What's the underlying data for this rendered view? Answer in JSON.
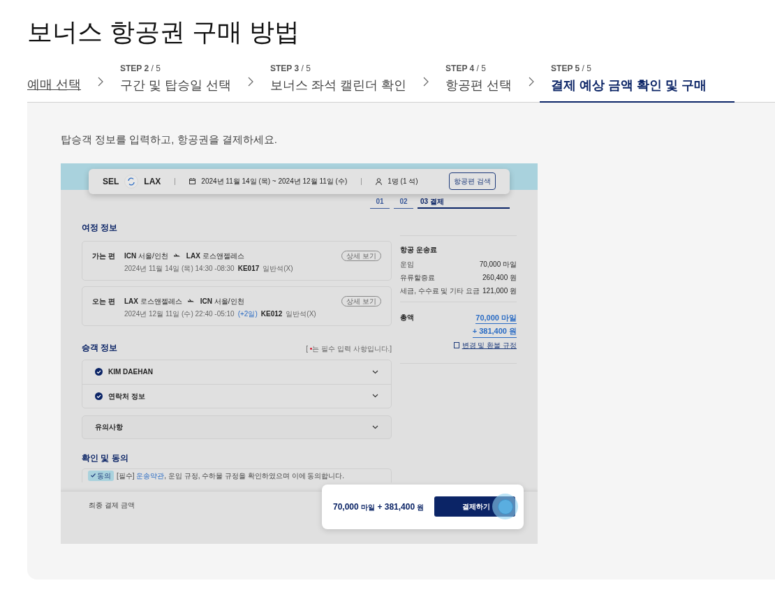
{
  "title": "보너스 항공권 구매 방법",
  "steps": [
    {
      "label": "예매 선택",
      "selected": false
    },
    {
      "step": "STEP 2",
      "total": "/ 5",
      "label": "구간 및 탑승일 선택",
      "selected": false
    },
    {
      "step": "STEP 3",
      "total": "/ 5",
      "label": "보너스 좌석 캘린더 확인",
      "selected": false
    },
    {
      "step": "STEP 4",
      "total": "/ 5",
      "label": "항공편 선택",
      "selected": false
    },
    {
      "step": "STEP 5",
      "total": "/ 5",
      "label": "결제 예상 금액 확인 및 구매",
      "selected": true
    }
  ],
  "instruction": "탑승객 정보를 입력하고, 항공권을 결제하세요.",
  "screenshot": {
    "search_bar": {
      "origin": "SEL",
      "destination": "LAX",
      "dates": "2024년 11월 14일 (목) ~ 2024년 12월 11일 (수)",
      "passengers": "1명 (1 석)",
      "button": "항공편 검색"
    },
    "progress": [
      {
        "label": "01",
        "selected": false
      },
      {
        "label": "02",
        "selected": false
      },
      {
        "label": "03 결제",
        "selected": true
      }
    ],
    "itinerary": {
      "title": "여정 정보",
      "flights": [
        {
          "direction": "가는 편",
          "from_code": "ICN",
          "from_city": "서울/인천",
          "to_code": "LAX",
          "to_city": "로스앤젤레스",
          "times": "2024년 11월 14일 (목) 14:30 -08:30",
          "flight_no": "KE017",
          "cabin": "일반석(X)",
          "button": "상세 보기"
        },
        {
          "direction": "오는 편",
          "from_code": "LAX",
          "from_city": "로스앤젤레스",
          "to_code": "ICN",
          "to_city": "서울/인천",
          "times": "2024년 12월 11일 (수) 22:40 -05:10",
          "extra": "(+2일)",
          "flight_no": "KE012",
          "cabin": "일반석(X)",
          "button": "상세 보기"
        }
      ]
    },
    "fare": {
      "title": "항공 운송료",
      "rows": [
        {
          "label": "운임",
          "value": "70,000 마일"
        },
        {
          "label": "유류할증료",
          "value": "260,400 원"
        },
        {
          "label": "세금, 수수료 및 기타 요금",
          "value": "121,000 원"
        }
      ],
      "total_label": "총액",
      "total_miles": "70,000 마일",
      "total_won": "+ 381,400 원",
      "rules_link": "변경 및 환불 규정"
    },
    "passengers": {
      "title": "승객 정보",
      "note_open": "[",
      "note_mark": "•",
      "note_rest": "는 필수 입력 사항입니다.]",
      "items": [
        {
          "label": "KIM DAEHAN",
          "checked": true
        },
        {
          "label": "연락처 정보",
          "checked": true
        }
      ],
      "notice": "유의사항"
    },
    "agreement": {
      "title": "확인 및 동의",
      "tag": "동의",
      "required": "[필수]",
      "link": "운송약관",
      "text": ", 운임 규정, 수하물 규정을 확인하였으며 이에 동의합니다."
    },
    "bottom": {
      "label": "최종 결제 금액",
      "miles": "70,000",
      "miles_unit": "마일",
      "plus": "+",
      "won": "381,400",
      "won_unit": "원",
      "button": "결제하기"
    }
  }
}
